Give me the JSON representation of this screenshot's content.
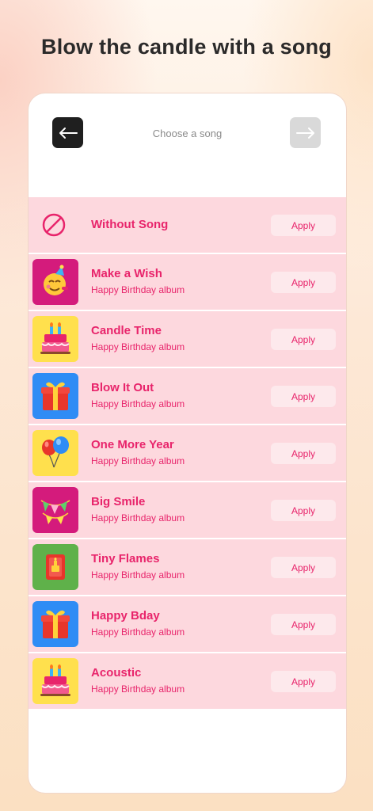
{
  "headline": "Blow the candle with a song",
  "header": {
    "title": "Choose a song",
    "back_icon": "arrow-left-icon",
    "next_icon": "arrow-right-icon"
  },
  "colors": {
    "accent": "#e8246b",
    "row_bg": "#fdd8de",
    "apply_bg": "#fde9ec"
  },
  "songs": [
    {
      "title": "Without Song",
      "subtitle": "",
      "apply_label": "Apply",
      "icon": "no-song-icon"
    },
    {
      "title": "Make a Wish",
      "subtitle": "Happy Birthday album",
      "apply_label": "Apply",
      "icon": "party-face-icon",
      "bg": "#d41b7c"
    },
    {
      "title": "Candle Time",
      "subtitle": "Happy Birthday album",
      "apply_label": "Apply",
      "icon": "birthday-cake-icon",
      "bg": "#ffe04d"
    },
    {
      "title": "Blow It Out",
      "subtitle": "Happy Birthday album",
      "apply_label": "Apply",
      "icon": "gift-icon",
      "bg": "#2f8cf5"
    },
    {
      "title": "One More Year",
      "subtitle": "Happy Birthday album",
      "apply_label": "Apply",
      "icon": "balloons-icon",
      "bg": "#ffe04d"
    },
    {
      "title": "Big Smile",
      "subtitle": "Happy Birthday album",
      "apply_label": "Apply",
      "icon": "bunting-icon",
      "bg": "#d41b7c"
    },
    {
      "title": "Tiny Flames",
      "subtitle": "Happy Birthday album",
      "apply_label": "Apply",
      "icon": "card-icon",
      "bg": "#5fb14a"
    },
    {
      "title": "Happy Bday",
      "subtitle": "Happy Birthday album",
      "apply_label": "Apply",
      "icon": "gift-icon",
      "bg": "#2f8cf5"
    },
    {
      "title": "Acoustic",
      "subtitle": "Happy Birthday album",
      "apply_label": "Apply",
      "icon": "birthday-cake-icon",
      "bg": "#ffe04d"
    }
  ]
}
